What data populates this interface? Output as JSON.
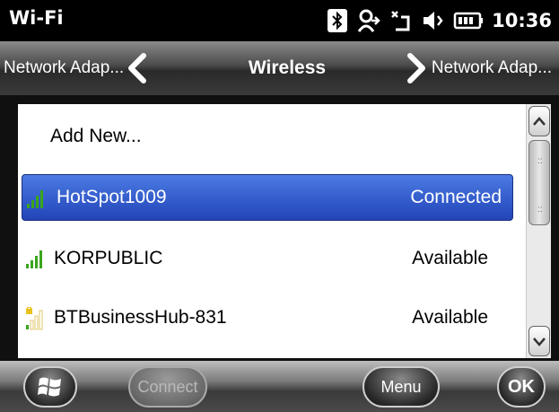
{
  "status_bar": {
    "title": "Wi-Fi",
    "time": "10:36",
    "icons": [
      "bluetooth-icon",
      "connection-icon",
      "sync-icon",
      "volume-icon",
      "battery-icon"
    ]
  },
  "nav": {
    "prev_label": "Network Adap...",
    "title": "Wireless",
    "next_label": "Network Adap..."
  },
  "list": {
    "add_new": "Add New...",
    "networks": [
      {
        "name": "HotSpot1009",
        "status": "Connected",
        "selected": true,
        "secured": false
      },
      {
        "name": "KORPUBLIC",
        "status": "Available",
        "selected": false,
        "secured": false
      },
      {
        "name": "BTBusinessHub-831",
        "status": "Available",
        "selected": false,
        "secured": true
      }
    ]
  },
  "bottom": {
    "connect_label": "Connect",
    "menu_label": "Menu",
    "ok_label": "OK"
  },
  "colors": {
    "selected_row": "#2f5ccf",
    "signal_green": "#3aa51c",
    "lock_yellow": "#e8c21a"
  }
}
